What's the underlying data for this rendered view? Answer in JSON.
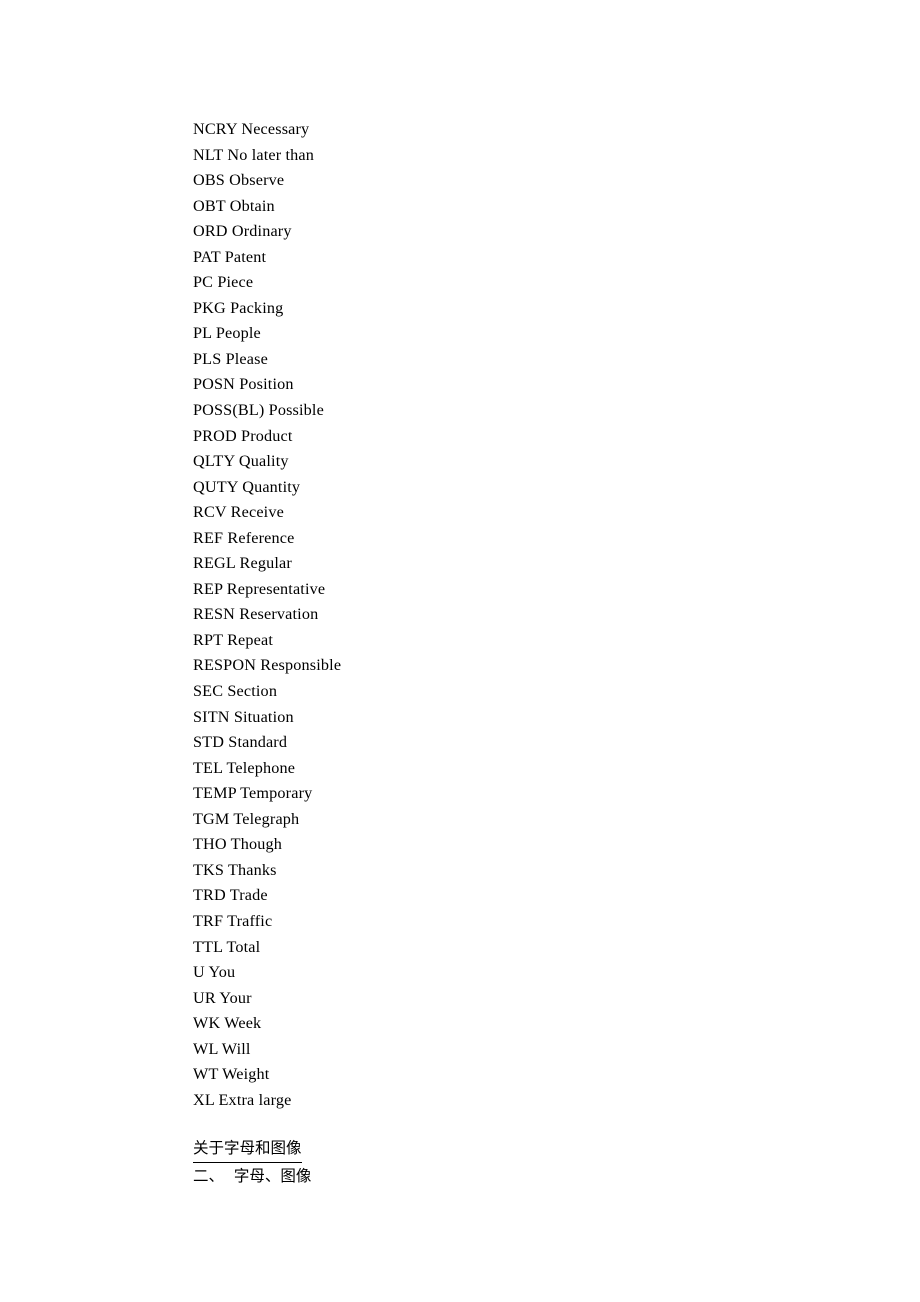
{
  "document": {
    "type": "text-document-page",
    "background_color": "#ffffff",
    "text_color": "#000000",
    "abbreviations": [
      "NCRY Necessary",
      "NLT No later than",
      "OBS Observe",
      "OBT Obtain",
      "ORD Ordinary",
      "PAT Patent",
      "PC Piece",
      "PKG Packing",
      "PL People",
      "PLS Please",
      "POSN Position",
      "POSS(BL) Possible",
      "PROD Product",
      "QLTY Quality",
      "QUTY Quantity",
      "RCV Receive",
      "REF Reference",
      "REGL Regular",
      "REP Representative",
      "RESN Reservation",
      "RPT Repeat",
      "RESPON Responsible",
      "SEC Section",
      "SITN Situation",
      "STD Standard",
      "TEL Telephone",
      "TEMP Temporary",
      "TGM Telegraph",
      "THO Though",
      "TKS Thanks",
      "TRD Trade",
      "TRF Traffic",
      "TTL Total",
      "U You",
      "UR Your",
      "WK Week",
      "WL Will",
      "WT Weight",
      "XL Extra large"
    ],
    "section": {
      "heading": "关于字母和图像",
      "subheading": "二、  字母、图像"
    }
  }
}
